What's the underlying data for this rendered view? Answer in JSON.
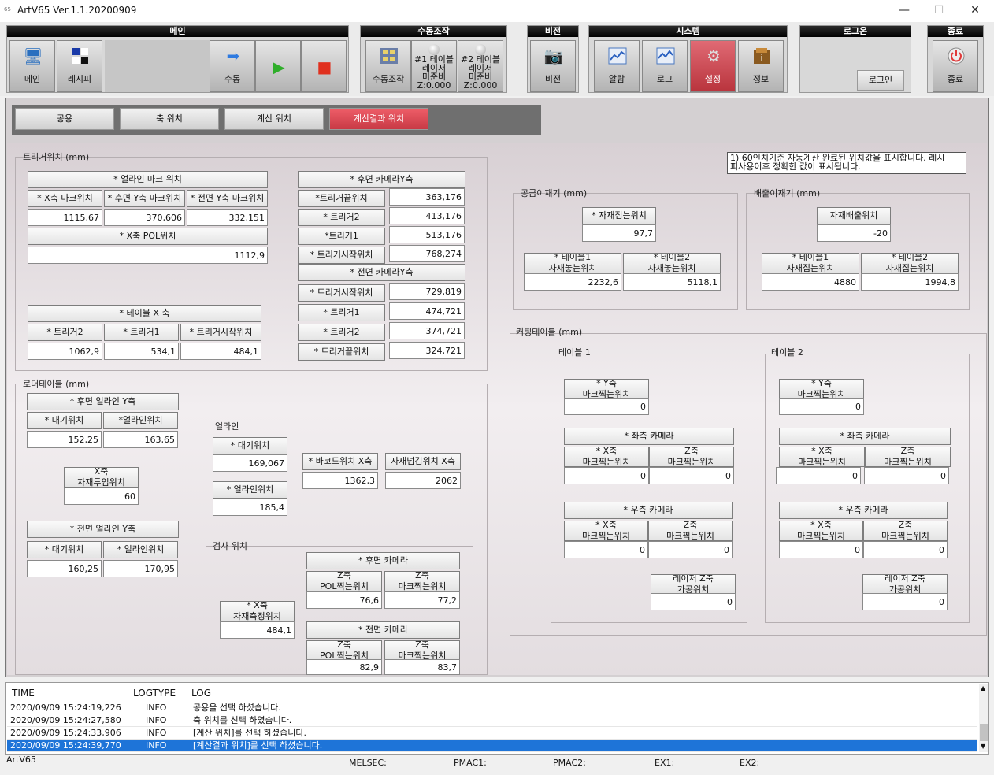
{
  "window": {
    "title": "ArtV65 Ver.1.1.20200909",
    "icon_label": "65",
    "minimize": "—",
    "maximize": "☐",
    "close": "✕"
  },
  "toolbar": {
    "main": {
      "title": "메인",
      "buttons": [
        "메인",
        "레시피",
        "수동"
      ]
    },
    "manual": {
      "title": "수동조작",
      "button": "수동조작",
      "table1": "#1 테이블\n레이저\n미준비\nZ:0.000",
      "table2": "#2 테이블\n레이저\n미준비\nZ:0.000"
    },
    "vision": {
      "title": "비전",
      "button": "비전"
    },
    "system": {
      "title": "시스템",
      "buttons": [
        "알람",
        "로그",
        "설정",
        "정보"
      ]
    },
    "login": {
      "title": "로그온",
      "button": "로그인"
    },
    "exit": {
      "title": "종료",
      "button": "종료"
    }
  },
  "tabs": [
    "공용",
    "축 위치",
    "계산 위치",
    "계산결과 위치"
  ],
  "note": "1) 60인치기준 자동계산 완료된 위치값을 표시합니다. 레시\n피사용이후 정확한 값이 표시됩니다.",
  "trigger": {
    "title": "트리거위치 (mm)",
    "align_mark": {
      "header": "* 얼라인 마크 위치",
      "labels": [
        "* X축 마크위치",
        "* 후면 Y축 마크위치",
        "* 전면 Y축 마크위치"
      ],
      "values": [
        "1115,67",
        "370,606",
        "332,151"
      ]
    },
    "x_pol": {
      "label": "* X축 POL위치",
      "value": "1112,9"
    },
    "table_x": {
      "header": "* 테이블 X 축",
      "labels": [
        "* 트리거2",
        "* 트리거1",
        "* 트리거시작위치"
      ],
      "values": [
        "1062,9",
        "534,1",
        "484,1"
      ]
    },
    "rear_cam": {
      "header": "* 후면 카메라Y축",
      "labels": [
        "*트리거끝위치",
        "* 트리거2",
        "*트리거1",
        "* 트리거시작위치"
      ],
      "values": [
        "363,176",
        "413,176",
        "513,176",
        "768,274"
      ]
    },
    "front_cam": {
      "header": "* 전면 카메라Y축",
      "labels": [
        "* 트리거시작위치",
        "* 트리거1",
        "* 트리거2",
        "* 트리거끝위치"
      ],
      "values": [
        "729,819",
        "474,721",
        "374,721",
        "324,721"
      ]
    }
  },
  "loader": {
    "title": "로더테이블 (mm)",
    "rear_align": {
      "header": "* 후면 얼라인 Y축",
      "labels": [
        "* 대기위치",
        "*얼라인위치"
      ],
      "values": [
        "152,25",
        "163,65"
      ]
    },
    "x_input": {
      "label": "X축\n자재투입위치",
      "value": "60"
    },
    "front_align": {
      "header": "* 전면 얼라인 Y축",
      "labels": [
        "* 대기위치",
        "* 얼라인위치"
      ],
      "values": [
        "160,25",
        "170,95"
      ]
    },
    "align": {
      "title": "얼라인",
      "labels": [
        "* 대기위치",
        "* 얼라인위치"
      ],
      "values": [
        "169,067",
        "185,4"
      ]
    },
    "barcode": {
      "label": "* 바코드위치 X축",
      "value": "1362,3"
    },
    "transfer": {
      "label": "자재넘김위치 X축",
      "value": "2062"
    },
    "inspect": {
      "title": "검사 위치",
      "x_measure": {
        "label": "* X축\n자재측정위치",
        "value": "484,1"
      },
      "rear_cam": {
        "header": "* 후면 카메라",
        "labels": [
          "Z축\nPOL찍는위치",
          "Z축\n마크찍는위치"
        ],
        "values": [
          "76,6",
          "77,2"
        ]
      },
      "front_cam": {
        "header": "* 전면 카메라",
        "labels": [
          "Z축\nPOL찍는위치",
          "Z축\n마크찍는위치"
        ],
        "values": [
          "82,9",
          "83,7"
        ]
      }
    }
  },
  "supply": {
    "title": "공급이재기 (mm)",
    "pick": {
      "label": "* 자재집는위치",
      "value": "97,7"
    },
    "labels": [
      "* 테이블1\n자재놓는위치",
      "* 테이블2\n자재놓는위치"
    ],
    "values": [
      "2232,6",
      "5118,1"
    ]
  },
  "discharge": {
    "title": "배출이재기 (mm)",
    "out": {
      "label": "자재배출위치",
      "value": "-20"
    },
    "labels": [
      "* 테이블1\n자재집는위치",
      "* 테이블2\n자재집는위치"
    ],
    "values": [
      "4880",
      "1994,8"
    ]
  },
  "cutting": {
    "title": "커팅테이블 (mm)",
    "tables": [
      {
        "title": "테이블 1",
        "y": {
          "label": "* Y축\n마크찍는위치",
          "value": "0"
        },
        "left": {
          "header": "* 좌측 카메라",
          "labels": [
            "* X축\n마크찍는위치",
            "Z축\n마크찍는위치"
          ],
          "values": [
            "0",
            "0"
          ]
        },
        "right": {
          "header": "* 우측 카메라",
          "labels": [
            "* X축\n마크찍는위치",
            "Z축\n마크찍는위치"
          ],
          "values": [
            "0",
            "0"
          ]
        },
        "laser": {
          "label": "레이저 Z축\n가공위치",
          "value": "0"
        }
      },
      {
        "title": "테이블 2",
        "y": {
          "label": "* Y축\n마크찍는위치",
          "value": "0"
        },
        "left": {
          "header": "* 좌측 카메라",
          "labels": [
            "* X축\n마크찍는위치",
            "Z축\n마크찍는위치"
          ],
          "values": [
            "0",
            "0"
          ]
        },
        "right": {
          "header": "* 우측 카메라",
          "labels": [
            "* X축\n마크찍는위치",
            "Z축\n마크찍는위치"
          ],
          "values": [
            "0",
            "0"
          ]
        },
        "laser": {
          "label": "레이저 Z축\n가공위치",
          "value": "0"
        }
      }
    ]
  },
  "log": {
    "headers": [
      "TIME",
      "LOGTYPE",
      "LOG"
    ],
    "rows": [
      {
        "time": "2020/09/09 15:24:19,226",
        "type": "INFO",
        "msg": "공용을 선택 하셨습니다."
      },
      {
        "time": "2020/09/09 15:24:27,580",
        "type": "INFO",
        "msg": "축 위치를 선택 하였습니다."
      },
      {
        "time": "2020/09/09 15:24:33,906",
        "type": "INFO",
        "msg": "[계산 위치]를 선택 하셨습니다."
      },
      {
        "time": "2020/09/09 15:24:39,770",
        "type": "INFO",
        "msg": "[계산결과 위치]를 선택 하셨습니다."
      }
    ]
  },
  "status": {
    "app": "ArtV65",
    "items": [
      "MELSEC:",
      "PMAC1:",
      "PMAC2:",
      "EX1:",
      "EX2:"
    ]
  }
}
